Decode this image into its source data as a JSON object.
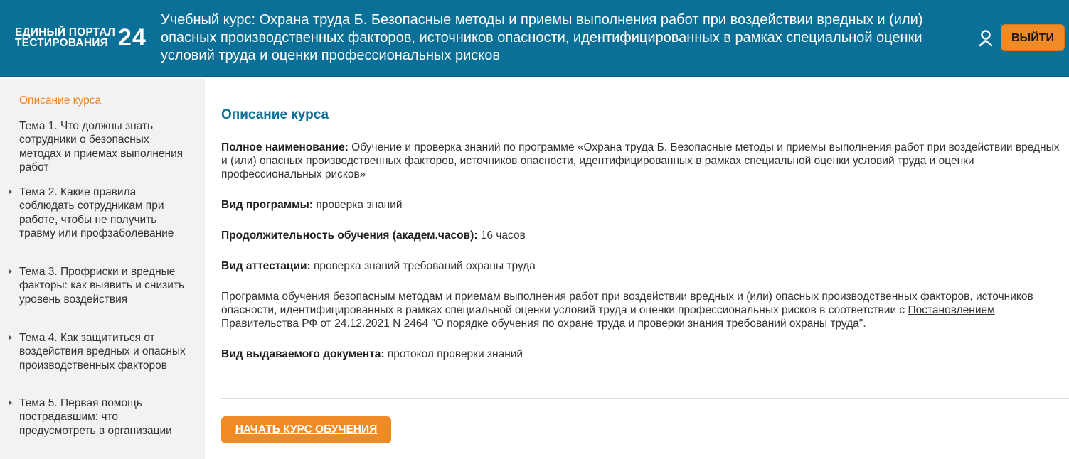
{
  "header": {
    "logo_line1": "ЕДИНЫЙ ПОРТАЛ",
    "logo_line2": "ТЕСТИРОВАНИЯ",
    "logo_number": "24",
    "course_title": "Учебный курс: Охрана труда Б. Безопасные методы и приемы выполнения работ при воздействии вредных и (или) опасных производственных факторов, источников опасности, идентифицированных в рамках специальной оценки условий труда и оценки профессиональных рисков",
    "user_icon": "user-icon",
    "logout_label": "ВЫЙТИ"
  },
  "sidebar": {
    "items": [
      {
        "label": "Описание курса"
      },
      {
        "label": "Тема 1. Что должны знать сотрудники о безопасных методах и приемах выполнения работ"
      },
      {
        "label": "Тема 2. Какие правила соблюдать сотрудникам при работе, чтобы не получить травму или профзаболевание"
      },
      {
        "label": "Тема 3. Профриски и вредные факторы: как выявить и снизить уровень воздействия"
      },
      {
        "label": "Тема 4. Как защититься от воздействия вредных и опасных производственных факторов"
      },
      {
        "label": "Тема 5. Первая помощь пострадавшим: что предусмотреть в организации"
      }
    ]
  },
  "main": {
    "section_title": "Описание курса",
    "full_name_label": "Полное наименование:",
    "full_name_value": " Обучение и проверка знаний по программе «Охрана труда Б. Безопасные методы и приемы выполнения работ при воздействии вредных и (или) опасных производственных факторов, источников опасности, идентифицированных в рамках специальной оценки условий труда и оценки профессиональных рисков»",
    "program_type_label": "Вид программы:",
    "program_type_value": " проверка знаний",
    "duration_label": "Продолжительность обучения (академ.часов):",
    "duration_value": " 16 часов",
    "attestation_label": "Вид аттестации:",
    "attestation_value": " проверка знаний требований охраны труда",
    "description_text": "Программа обучения безопасным методам и приемам выполнения работ при воздействии вредных и (или) опасных производственных факторов, источников опасности, идентифицированных в рамках специальной оценки условий труда и оценки профессиональных рисков в соответствии с ",
    "description_link": "Постановлением Правительства РФ от 24.12.2021 N 2464 \"О порядке обучения по охране труда и проверки знания требований охраны труда\"",
    "description_end": ".",
    "document_label": "Вид выдаваемого документа:",
    "document_value": " протокол проверки знаний",
    "start_button": "НАЧАТЬ КУРС ОБУЧЕНИЯ"
  },
  "colors": {
    "header_bg": "#0a7097",
    "accent_orange": "#f08a24",
    "title_blue": "#0a7097",
    "sidebar_bg": "#f2f2f2",
    "active_item": "#e8882a"
  }
}
